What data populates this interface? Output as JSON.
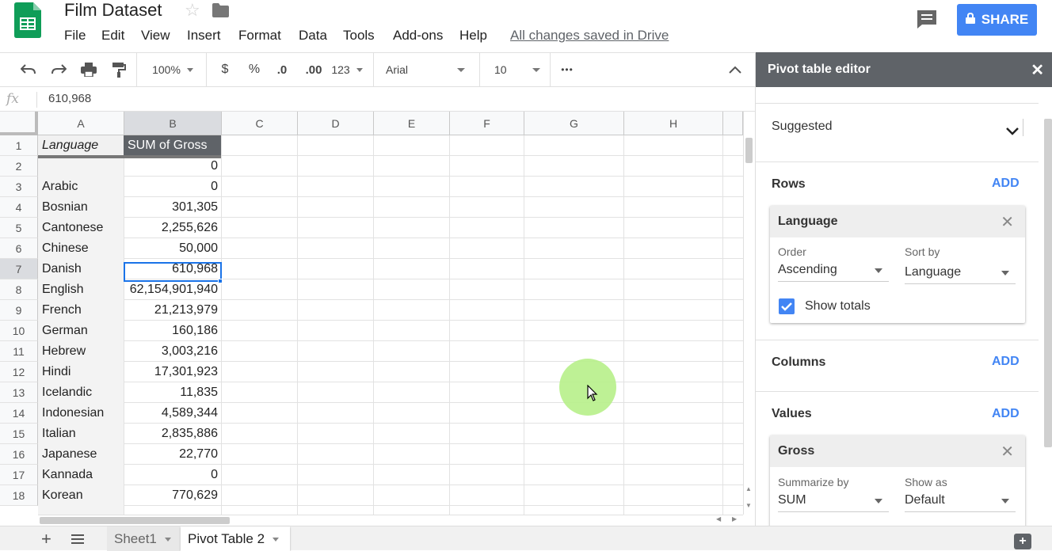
{
  "app": {
    "doc_title": "Film Dataset",
    "saved_status": "All changes saved in Drive",
    "share_label": "SHARE"
  },
  "menu": [
    "File",
    "Edit",
    "View",
    "Insert",
    "Format",
    "Data",
    "Tools",
    "Add-ons",
    "Help"
  ],
  "toolbar": {
    "zoom": "100%",
    "currency": "$",
    "percent": "%",
    "dec_decrease": ".0",
    "dec_increase": ".00",
    "more_formats": "123",
    "font": "Arial",
    "font_size": "10",
    "more": "•••"
  },
  "formula_bar": {
    "fx": "fx",
    "value": "610,968"
  },
  "columns": [
    "A",
    "B",
    "C",
    "D",
    "E",
    "F",
    "G",
    "H"
  ],
  "rows": [
    {
      "num": "1",
      "a": "Language",
      "b": "SUM of Gross"
    },
    {
      "num": "2",
      "a": "",
      "b": "0"
    },
    {
      "num": "3",
      "a": "Arabic",
      "b": "0"
    },
    {
      "num": "4",
      "a": "Bosnian",
      "b": "301,305"
    },
    {
      "num": "5",
      "a": "Cantonese",
      "b": "2,255,626"
    },
    {
      "num": "6",
      "a": "Chinese",
      "b": "50,000"
    },
    {
      "num": "7",
      "a": "Danish",
      "b": "610,968"
    },
    {
      "num": "8",
      "a": "English",
      "b": "62,154,901,940"
    },
    {
      "num": "9",
      "a": "French",
      "b": "21,213,979"
    },
    {
      "num": "10",
      "a": "German",
      "b": "160,186"
    },
    {
      "num": "11",
      "a": "Hebrew",
      "b": "3,003,216"
    },
    {
      "num": "12",
      "a": "Hindi",
      "b": "17,301,923"
    },
    {
      "num": "13",
      "a": "Icelandic",
      "b": "11,835"
    },
    {
      "num": "14",
      "a": "Indonesian",
      "b": "4,589,344"
    },
    {
      "num": "15",
      "a": "Italian",
      "b": "2,835,886"
    },
    {
      "num": "16",
      "a": "Japanese",
      "b": "22,770"
    },
    {
      "num": "17",
      "a": "Kannada",
      "b": "0"
    },
    {
      "num": "18",
      "a": "Korean",
      "b": "770,629"
    }
  ],
  "sheets": {
    "tab1": "Sheet1",
    "tab2": "Pivot Table 2"
  },
  "pivot": {
    "title": "Pivot table editor",
    "close": "✕",
    "suggested": "Suggested",
    "rows_label": "Rows",
    "columns_label": "Columns",
    "values_label": "Values",
    "add": "ADD",
    "row_card": {
      "field": "Language",
      "order_label": "Order",
      "order_value": "Ascending",
      "sortby_label": "Sort by",
      "sortby_value": "Language",
      "show_totals": "Show totals"
    },
    "value_card": {
      "field": "Gross",
      "summarize_label": "Summarize by",
      "summarize_value": "SUM",
      "showas_label": "Show as",
      "showas_value": "Default"
    }
  },
  "colors": {
    "accent": "#4285f4",
    "sheets_green": "#0f9d58",
    "pivot_header": "#5f6368",
    "cursor_highlight": "#b7f08a"
  }
}
